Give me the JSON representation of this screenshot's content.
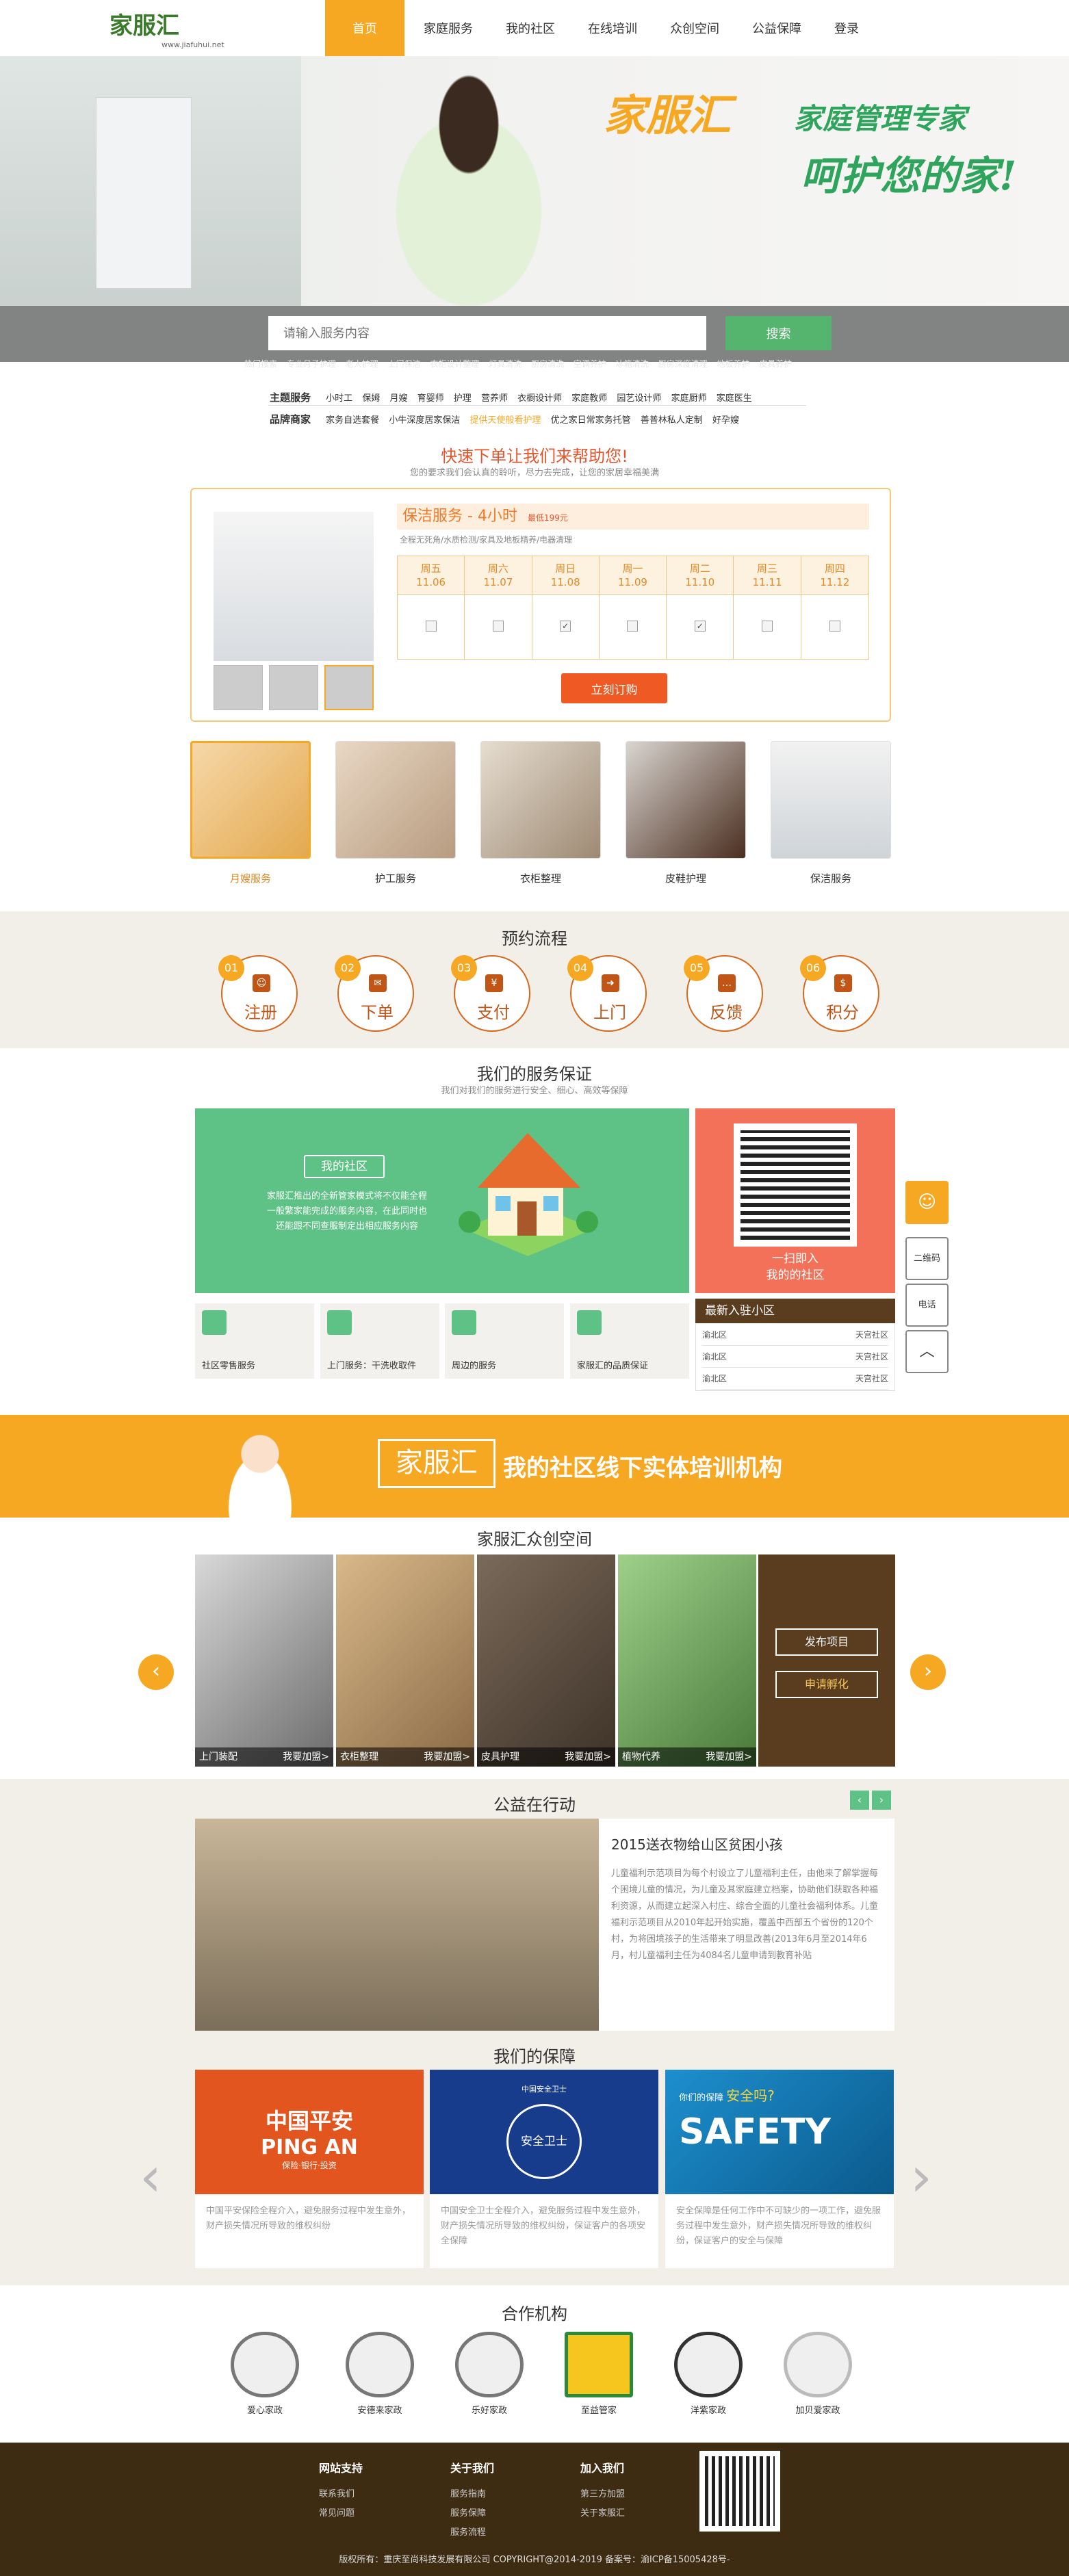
{
  "nav": {
    "logo": "家服汇",
    "logo_sub": "www.jiafuhui.net",
    "items": [
      "首页",
      "家庭服务",
      "我的社区",
      "在线培训",
      "众创空间",
      "公益保障",
      "登录"
    ]
  },
  "banner": {
    "slogan_brand": "家服汇",
    "slogan_line1": "家庭管理专家",
    "slogan_line2": "呵护您的家!",
    "search_placeholder": "请输入服务内容",
    "search_button": "搜索",
    "hot_words": [
      "热门搜索",
      "专业月子护理",
      "老人护理",
      "上门保洁",
      "衣柜设计整理",
      "灯具清洗",
      "厨房清洗",
      "空调养护",
      "冰箱清洗",
      "厨房深度清理",
      "地板养护",
      "皮具养护"
    ]
  },
  "tags": {
    "theme_label": "主题服务",
    "theme_items": [
      "小时工",
      "保姆",
      "月嫂",
      "育婴师",
      "护理",
      "营养师",
      "衣橱设计师",
      "家庭教师",
      "园艺设计师",
      "家庭厨师",
      "家庭医生"
    ],
    "brand_label": "品牌商家",
    "brand_items": [
      "家务自选套餐",
      "小牛深度居家保洁",
      "提供天使般看护理",
      "优之家日常家务托管",
      "善普林私人定制",
      "好孕嫂"
    ]
  },
  "quick_order": {
    "title": "快速下单让我们来帮助您!",
    "subtitle": "您的要求我们会认真的聆听，尽力去完成，让您的家居幸福美满",
    "service_name": "保洁服务 - 4小时",
    "price": "最低199元",
    "desc": "全程无死角/水质检测/家具及地板精养/电器清理",
    "days": [
      {
        "week": "周五",
        "date": "11.06",
        "checked": false
      },
      {
        "week": "周六",
        "date": "11.07",
        "checked": false
      },
      {
        "week": "周日",
        "date": "11.08",
        "checked": true
      },
      {
        "week": "周一",
        "date": "11.09",
        "checked": false
      },
      {
        "week": "周二",
        "date": "11.10",
        "checked": true
      },
      {
        "week": "周三",
        "date": "11.11",
        "checked": false
      },
      {
        "week": "周四",
        "date": "11.12",
        "checked": false
      }
    ],
    "order_button": "立刻订购"
  },
  "service_cards": [
    "月嫂服务",
    "护工服务",
    "衣柜整理",
    "皮鞋护理",
    "保洁服务"
  ],
  "process": {
    "title": "预约流程",
    "steps": [
      {
        "num": "01",
        "label": "注册"
      },
      {
        "num": "02",
        "label": "下单"
      },
      {
        "num": "03",
        "label": "支付"
      },
      {
        "num": "04",
        "label": "上门"
      },
      {
        "num": "05",
        "label": "反馈"
      },
      {
        "num": "06",
        "label": "积分"
      }
    ]
  },
  "guarantee": {
    "title": "我们的服务保证",
    "subtitle": "我们对我们的服务进行安全、细心、高效等保障",
    "badge": "我的社区",
    "text": "家服汇推出的全新管家模式将不仅能全程一般繁家能完成的服务内容，在此同时也还能跟不同查服制定出相应服务内容",
    "qr_text1": "一扫即入",
    "qr_text2": "我的的社区",
    "cards": [
      "社区零售服务",
      "上门服务：干洗收取件",
      "周边的服务",
      "家服汇的品质保证"
    ],
    "new_title": "最新入驻小区",
    "new_rows": [
      {
        "name": "渝北区",
        "place": "天宫社区"
      },
      {
        "name": "渝北区",
        "place": "天宫社区"
      },
      {
        "name": "渝北区",
        "place": "天宫社区"
      }
    ]
  },
  "side": {
    "qr": "二维码",
    "phone": "电话",
    "top": "︿",
    "service_icon": "☺"
  },
  "training": {
    "logo": "家服汇",
    "text": "我的社区线下实体培训机构"
  },
  "maker": {
    "title": "家服汇众创空间",
    "items": [
      {
        "name": "上门装配",
        "join": "我要加盟>"
      },
      {
        "name": "衣柜整理",
        "join": "我要加盟>"
      },
      {
        "name": "皮具护理",
        "join": "我要加盟>"
      },
      {
        "name": "植物代养",
        "join": "我要加盟>"
      }
    ],
    "btn1": "发布项目",
    "btn2": "申请孵化",
    "prev": "‹",
    "next": "›"
  },
  "welfare": {
    "title": "公益在行动",
    "prev": "‹",
    "next": "›",
    "headline": "2015送衣物给山区贫困小孩",
    "body": "儿童福利示范项目为每个村设立了儿童福利主任，由他来了解掌握每个困境儿童的情况，为儿童及其家庭建立档案，协助他们获取各种福利资源，从而建立起深入村庄、综合全面的儿童社会福利体系。儿童福利示范项目从2010年起开始实施，覆盖中西部五个省份的120个村，为将困境孩子的生活带来了明显改善(2013年6月至2014年6月，村儿童福利主任为4084名儿童申请到教育补贴"
  },
  "ours": {
    "title": "我们的保障",
    "cards": [
      {
        "logo": "中国平安",
        "logo_en": "PING AN",
        "slogan": "保险·银行·投资",
        "text": "中国平安保险全程介入，避免服务过程中发生意外，财产损失情况所导致的维权纠纷"
      },
      {
        "logo": "中国安全卫士",
        "logo_en": "安全卫士",
        "slogan": "",
        "text": "中国安全卫士全程介入，避免服务过程中发生意外，财产损失情况所导致的维权纠纷，保证客户的各项安全保障"
      },
      {
        "logo": "你们的保障",
        "logo_en": "SAFETY",
        "slogan": "安全吗?",
        "text": "安全保障是任何工作中不可缺少的一项工作，避免服务过程中发生意外，财产损失情况所导致的维权纠纷，保证客户的安全与保障"
      }
    ]
  },
  "partners": {
    "title": "合作机构",
    "items": [
      "爱心家政",
      "安德来家政",
      "乐好家政",
      "至益管家",
      "洋紫家政",
      "加贝爱家政"
    ]
  },
  "footer": {
    "col1": {
      "title": "网站支持",
      "items": [
        "联系我们",
        "常见问题"
      ]
    },
    "col2": {
      "title": "关于我们",
      "items": [
        "服务指南",
        "服务保障",
        "服务流程"
      ]
    },
    "col3": {
      "title": "加入我们",
      "items": [
        "第三方加盟",
        "关于家服汇"
      ]
    },
    "copyright": "版权所有：重庆至尚科技发展有限公司 COPYRIGHT@2014-2019 备案号：渝ICP备15005428号-"
  },
  "colors": {
    "accent": "#f7a823",
    "green": "#5ec185",
    "brown": "#5a3c1f",
    "red": "#ef5a24"
  }
}
